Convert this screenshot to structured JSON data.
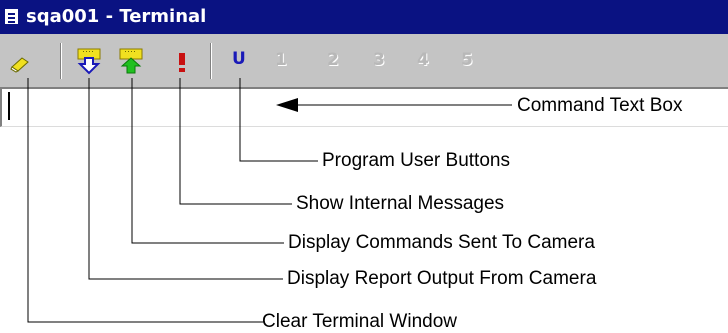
{
  "window": {
    "title": "sqa001 - Terminal"
  },
  "toolbar": {
    "buttons": [
      {
        "icon": "eraser-icon",
        "tooltip": "Clear Terminal Window"
      },
      {
        "icon": "report-output-icon",
        "tooltip": "Display Report Output From Camera"
      },
      {
        "icon": "commands-sent-icon",
        "tooltip": "Display Commands Sent To Camera"
      },
      {
        "icon": "exclamation-icon",
        "glyph": "!",
        "tooltip": "Show Internal Messages"
      },
      {
        "icon": "user-buttons-icon",
        "glyph": "U",
        "tooltip": "Program User Buttons"
      }
    ],
    "user_buttons": [
      "1",
      "2",
      "3",
      "4",
      "5"
    ]
  },
  "command_box": {
    "value": ""
  },
  "callouts": {
    "command_text_box": "Command Text Box",
    "program_user_buttons": "Program User Buttons",
    "show_internal_messages": "Show Internal Messages",
    "display_commands": "Display Commands Sent To Camera",
    "display_report": "Display Report Output From Camera",
    "clear_terminal": "Clear Terminal Window"
  },
  "colors": {
    "titlebar": "#0a1282",
    "toolbar": "#c4c4c4",
    "icon_yellow": "#f0e020",
    "icon_blue": "#1a1ab8",
    "icon_green": "#20c020",
    "exclamation_red": "#c81010"
  }
}
